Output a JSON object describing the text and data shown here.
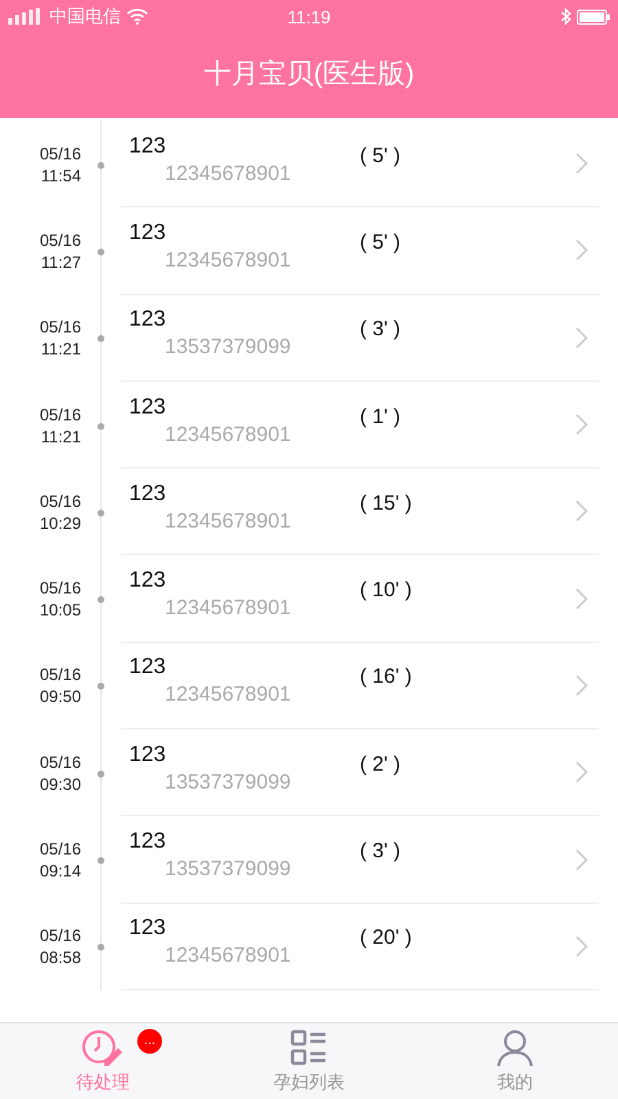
{
  "status_bar": {
    "carrier": "中国电信",
    "time": "11:19"
  },
  "header": {
    "title": "十月宝贝(医生版)"
  },
  "records": [
    {
      "date": "05/16",
      "time": "11:54",
      "name": "123",
      "phone": "12345678901",
      "duration": "( 5' )"
    },
    {
      "date": "05/16",
      "time": "11:27",
      "name": "123",
      "phone": "12345678901",
      "duration": "( 5' )"
    },
    {
      "date": "05/16",
      "time": "11:21",
      "name": "123",
      "phone": "13537379099",
      "duration": "( 3' )"
    },
    {
      "date": "05/16",
      "time": "11:21",
      "name": "123",
      "phone": "12345678901",
      "duration": "( 1' )"
    },
    {
      "date": "05/16",
      "time": "10:29",
      "name": "123",
      "phone": "12345678901",
      "duration": "( 15' )"
    },
    {
      "date": "05/16",
      "time": "10:05",
      "name": "123",
      "phone": "12345678901",
      "duration": "( 10' )"
    },
    {
      "date": "05/16",
      "time": "09:50",
      "name": "123",
      "phone": "12345678901",
      "duration": "( 16' )"
    },
    {
      "date": "05/16",
      "time": "09:30",
      "name": "123",
      "phone": "13537379099",
      "duration": "( 2' )"
    },
    {
      "date": "05/16",
      "time": "09:14",
      "name": "123",
      "phone": "13537379099",
      "duration": "( 3' )"
    },
    {
      "date": "05/16",
      "time": "08:58",
      "name": "123",
      "phone": "12345678901",
      "duration": "( 20' )"
    }
  ],
  "tabs": [
    {
      "kind": "pending",
      "label": "待处理",
      "selected": true,
      "badge": "..."
    },
    {
      "kind": "list",
      "label": "孕妇列表",
      "selected": false
    },
    {
      "kind": "profile",
      "label": "我的",
      "selected": false
    }
  ]
}
